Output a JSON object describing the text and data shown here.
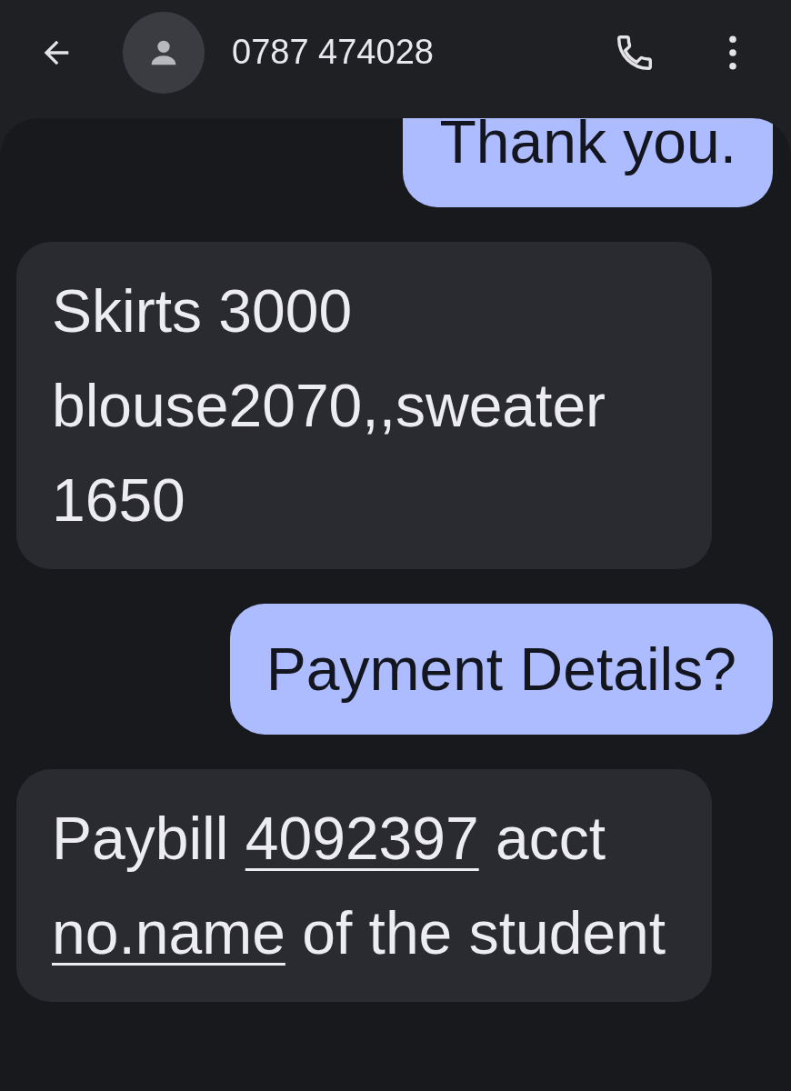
{
  "header": {
    "title": "0787 474028"
  },
  "messages": [
    {
      "kind": "outgoing",
      "parts": [
        {
          "text": "Thank you.",
          "link": false
        }
      ]
    },
    {
      "kind": "incoming",
      "parts": [
        {
          "text": "Skirts 3000 blouse2070,,sweater 1650",
          "link": false
        }
      ]
    },
    {
      "kind": "outgoing",
      "parts": [
        {
          "text": "Payment Details?",
          "link": false
        }
      ]
    },
    {
      "kind": "incoming",
      "parts": [
        {
          "text": "Paybill ",
          "link": false
        },
        {
          "text": "4092397",
          "link": true
        },
        {
          "text": " acct ",
          "link": false
        },
        {
          "text": "no.name",
          "link": true
        },
        {
          "text": " of the student",
          "link": false
        }
      ]
    }
  ]
}
